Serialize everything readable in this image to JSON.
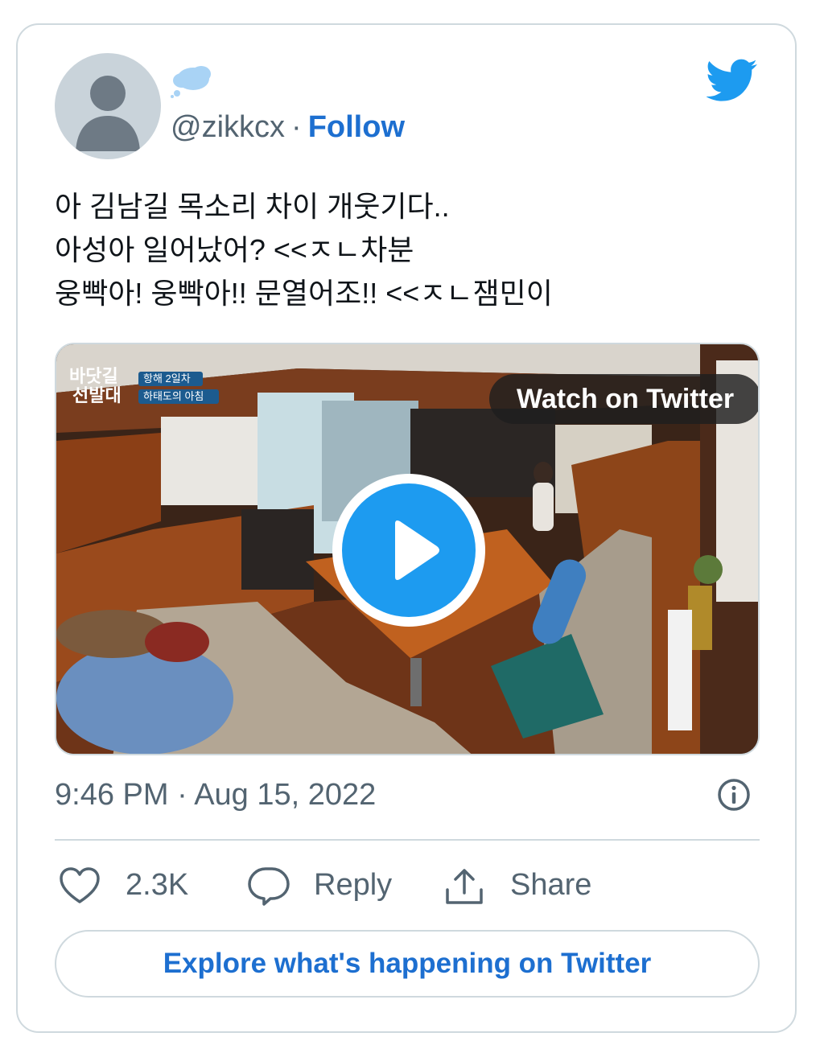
{
  "tweet": {
    "handle": "@zikkcx",
    "separator": "·",
    "follow_label": "Follow",
    "text_lines": [
      "아 김남길 목소리 차이 개웃기다..",
      "아성아 일어났어? <<ㅈㄴ차분",
      "웅빡아! 웅빡아!! 문열어조!! <<ㅈㄴ잼민이"
    ],
    "media": {
      "watch_label": "Watch on Twitter",
      "logo_line1": "바닷길",
      "logo_line2": "선발대",
      "caption_tag": "항해 2일차",
      "caption_text": "하태도의 아침"
    },
    "timestamp": "9:46 PM · Aug 15, 2022",
    "likes": "2.3K",
    "reply_label": "Reply",
    "share_label": "Share",
    "explore_label": "Explore what's happening on Twitter"
  },
  "icons": {
    "brand": "twitter-bird-icon",
    "like": "heart-icon",
    "reply": "speech-bubble-icon",
    "share": "upload-icon",
    "info": "info-icon",
    "play": "play-icon"
  },
  "colors": {
    "link_blue": "#1d6fd0",
    "brand_blue": "#1d9bf0",
    "secondary_text": "#536471",
    "border": "#cfd9de"
  }
}
